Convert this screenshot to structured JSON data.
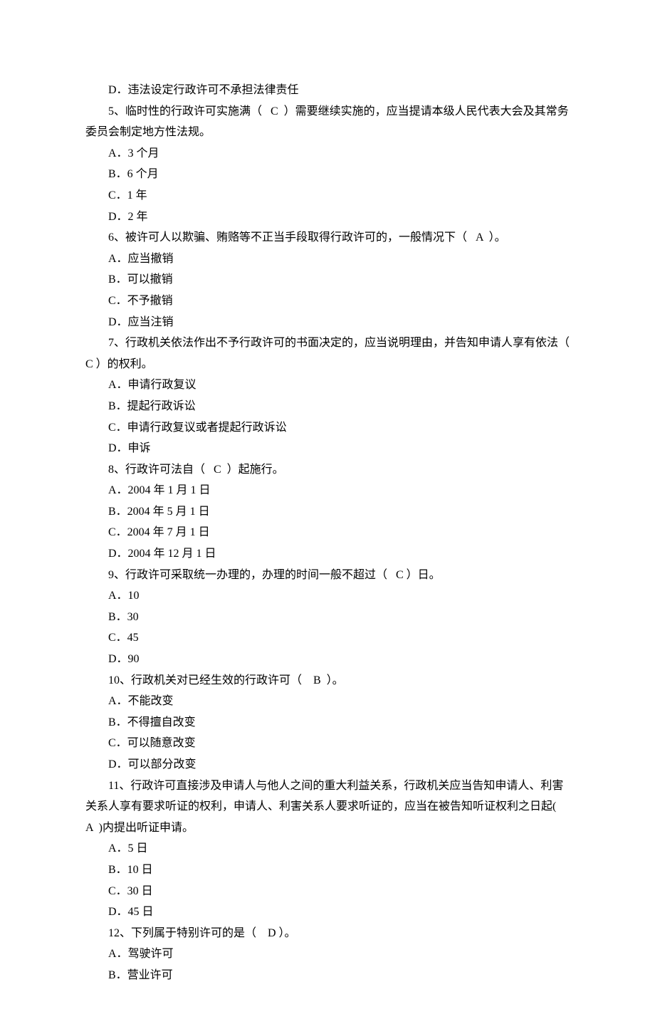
{
  "lines": [
    {
      "text": "D．违法设定行政许可不承担法律责任",
      "indent": true
    },
    {
      "text": "5、临时性的行政许可实施满（   C  ）需要继续实施的，应当提请本级人民代表大会及其常务委员会制定地方性法规。",
      "indent": true,
      "noIndentWrap": true
    },
    {
      "text": "A．3 个月",
      "indent": true
    },
    {
      "text": "B．6 个月",
      "indent": true
    },
    {
      "text": "C．1 年",
      "indent": true
    },
    {
      "text": "D．2 年",
      "indent": true
    },
    {
      "text": "6、被许可人以欺骗、贿赂等不正当手段取得行政许可的，一般情况下（   A  ）。",
      "indent": true
    },
    {
      "text": "A．应当撤销",
      "indent": true
    },
    {
      "text": "B．可以撤销",
      "indent": true
    },
    {
      "text": "C．不予撤销",
      "indent": true
    },
    {
      "text": "D．应当注销",
      "indent": true
    },
    {
      "text": "7、行政机关依法作出不予行政许可的书面决定的，应当说明理由，并告知申请人享有依法（  C ）的权利。",
      "indent": true,
      "noIndentWrap": true
    },
    {
      "text": "A．申请行政复议",
      "indent": true
    },
    {
      "text": "B．提起行政诉讼",
      "indent": true
    },
    {
      "text": "C．申请行政复议或者提起行政诉讼",
      "indent": true
    },
    {
      "text": "D．申诉",
      "indent": true
    },
    {
      "text": "8、行政许可法自（   C  ）起施行。",
      "indent": true
    },
    {
      "text": "A．2004 年 1 月 1 日",
      "indent": true
    },
    {
      "text": "B．2004 年 5 月 1 日",
      "indent": true
    },
    {
      "text": "C．2004 年 7 月 1 日",
      "indent": true
    },
    {
      "text": "D．2004 年 12 月 1 日",
      "indent": true
    },
    {
      "text": "9、行政许可采取统一办理的，办理的时间一般不超过（   C ）日。",
      "indent": true
    },
    {
      "text": "A．10",
      "indent": true
    },
    {
      "text": "B．30",
      "indent": true
    },
    {
      "text": "C．45",
      "indent": true
    },
    {
      "text": "D．90",
      "indent": true
    },
    {
      "text": "10、行政机关对已经生效的行政许可（    B  ）。",
      "indent": true
    },
    {
      "text": "A．不能改变",
      "indent": true
    },
    {
      "text": "B．不得擅自改变",
      "indent": true
    },
    {
      "text": "C．可以随意改变",
      "indent": true
    },
    {
      "text": "D．可以部分改变",
      "indent": true
    },
    {
      "text": "11、行政许可直接涉及申请人与他人之间的重大利益关系，行政机关应当告知申请人、利害关系人享有要求听证的权利，申请人、利害关系人要求听证的，应当在被告知听证权利之日起(   A  )内提出听证申请。",
      "indent": true,
      "noIndentWrap": true
    },
    {
      "text": "A．5 日",
      "indent": true
    },
    {
      "text": "B．10 日",
      "indent": true
    },
    {
      "text": "C．30 日",
      "indent": true
    },
    {
      "text": "D．45 日",
      "indent": true
    },
    {
      "text": "12、下列属于特别许可的是（    D ）。",
      "indent": true
    },
    {
      "text": "A．驾驶许可",
      "indent": true
    },
    {
      "text": "B．营业许可",
      "indent": true
    }
  ]
}
